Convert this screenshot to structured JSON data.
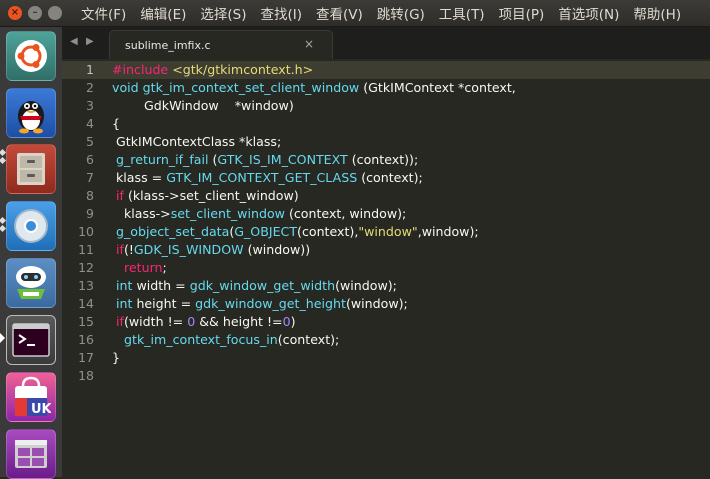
{
  "menubar": {
    "items": [
      "文件(F)",
      "编辑(E)",
      "选择(S)",
      "查找(I)",
      "查看(V)",
      "跳转(G)",
      "工具(T)",
      "项目(P)",
      "首选项(N)",
      "帮助(H)"
    ],
    "window_buttons": [
      "close-icon",
      "minimize-icon",
      "maximize-icon"
    ]
  },
  "launcher": {
    "items": [
      {
        "name": "ubuntu-dash",
        "icon": "ubuntu-logo-icon",
        "color": "#3d8a82"
      },
      {
        "name": "qq",
        "icon": "penguin-icon",
        "color": "#2a62c4"
      },
      {
        "name": "files",
        "icon": "file-cabinet-icon",
        "color": "#b53a2e"
      },
      {
        "name": "chromium",
        "icon": "chromium-icon",
        "color": "#3a8ed6"
      },
      {
        "name": "monitor-app",
        "icon": "robot-icon",
        "color": "#6cbf3c"
      },
      {
        "name": "terminal",
        "icon": "terminal-icon",
        "color": "#2c2c2c"
      },
      {
        "name": "ubuntu-store",
        "icon": "shopping-bag-icon",
        "color": "#d64b8a",
        "text": "UK"
      },
      {
        "name": "workspace-switcher",
        "icon": "workspaces-icon",
        "color": "#8e3aa3"
      }
    ]
  },
  "editor": {
    "tab_title": "sublime_imfix.c",
    "tab_close": "×",
    "nav_back": "◀",
    "nav_forward": "▶",
    "active_line": 1,
    "lines": [
      [
        {
          "t": "#include ",
          "c": "pp"
        },
        {
          "t": "<gtk/gtkimcontext.h>",
          "c": "str"
        }
      ],
      [
        {
          "t": "void ",
          "c": "type"
        },
        {
          "t": "gtk_im_context_set_client_window",
          "c": "fn"
        },
        {
          "t": " (GtkIMContext *context,",
          "c": "plain"
        }
      ],
      [
        {
          "t": "        GdkWindow    *window)",
          "c": "plain"
        }
      ],
      [
        {
          "t": "{",
          "c": "plain"
        }
      ],
      [
        {
          "t": " GtkIMContextClass *klass;",
          "c": "plain"
        }
      ],
      [
        {
          "t": " ",
          "c": "plain"
        },
        {
          "t": "g_return_if_fail",
          "c": "fn"
        },
        {
          "t": " (",
          "c": "plain"
        },
        {
          "t": "GTK_IS_IM_CONTEXT",
          "c": "macro"
        },
        {
          "t": " (context));",
          "c": "plain"
        }
      ],
      [
        {
          "t": " klass = ",
          "c": "plain"
        },
        {
          "t": "GTK_IM_CONTEXT_GET_CLASS",
          "c": "macro"
        },
        {
          "t": " (context);",
          "c": "plain"
        }
      ],
      [
        {
          "t": " ",
          "c": "plain"
        },
        {
          "t": "if",
          "c": "kw"
        },
        {
          "t": " (klass->set_client_window)",
          "c": "plain"
        }
      ],
      [
        {
          "t": "   klass->",
          "c": "plain"
        },
        {
          "t": "set_client_window",
          "c": "fn"
        },
        {
          "t": " (context, window);",
          "c": "plain"
        }
      ],
      [
        {
          "t": " ",
          "c": "plain"
        },
        {
          "t": "g_object_set_data",
          "c": "fn"
        },
        {
          "t": "(",
          "c": "plain"
        },
        {
          "t": "G_OBJECT",
          "c": "macro"
        },
        {
          "t": "(context),",
          "c": "plain"
        },
        {
          "t": "\"window\"",
          "c": "str"
        },
        {
          "t": ",window);",
          "c": "plain"
        }
      ],
      [
        {
          "t": " ",
          "c": "plain"
        },
        {
          "t": "if",
          "c": "kw"
        },
        {
          "t": "(!",
          "c": "plain"
        },
        {
          "t": "GDK_IS_WINDOW",
          "c": "macro"
        },
        {
          "t": " (window))",
          "c": "plain"
        }
      ],
      [
        {
          "t": "   ",
          "c": "plain"
        },
        {
          "t": "return",
          "c": "kw"
        },
        {
          "t": ";",
          "c": "plain"
        }
      ],
      [
        {
          "t": " ",
          "c": "plain"
        },
        {
          "t": "int",
          "c": "type"
        },
        {
          "t": " width = ",
          "c": "plain"
        },
        {
          "t": "gdk_window_get_width",
          "c": "fn"
        },
        {
          "t": "(window);",
          "c": "plain"
        }
      ],
      [
        {
          "t": " ",
          "c": "plain"
        },
        {
          "t": "int",
          "c": "type"
        },
        {
          "t": " height = ",
          "c": "plain"
        },
        {
          "t": "gdk_window_get_height",
          "c": "fn"
        },
        {
          "t": "(window);",
          "c": "plain"
        }
      ],
      [
        {
          "t": " ",
          "c": "plain"
        },
        {
          "t": "if",
          "c": "kw"
        },
        {
          "t": "(width != ",
          "c": "plain"
        },
        {
          "t": "0",
          "c": "num"
        },
        {
          "t": " && height !=",
          "c": "plain"
        },
        {
          "t": "0",
          "c": "num"
        },
        {
          "t": ")",
          "c": "plain"
        }
      ],
      [
        {
          "t": "   ",
          "c": "plain"
        },
        {
          "t": "gtk_im_context_focus_in",
          "c": "fn"
        },
        {
          "t": "(context);",
          "c": "plain"
        }
      ],
      [
        {
          "t": "}",
          "c": "plain"
        }
      ],
      []
    ]
  }
}
